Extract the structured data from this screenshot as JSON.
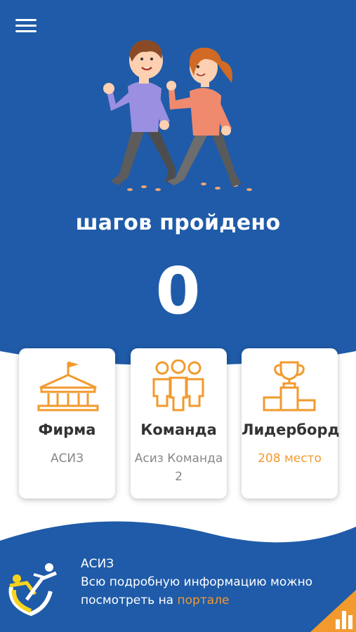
{
  "header": {
    "menu_icon": "hamburger-icon"
  },
  "hero": {
    "illustration": "walking-couple"
  },
  "steps": {
    "label": "шагов пройдено",
    "value": "0"
  },
  "cards": [
    {
      "icon": "company-building-icon",
      "title": "Фирма",
      "subtitle": "АСИЗ"
    },
    {
      "icon": "team-people-icon",
      "title": "Команда",
      "subtitle": "Асиз Команда 2"
    },
    {
      "icon": "trophy-podium-icon",
      "title": "Лидерборд",
      "subtitle": "208 место"
    }
  ],
  "footer": {
    "org": "АСИЗ",
    "info_text": "Всю подробную информацию можно посмотреть на",
    "link_text": "порталe",
    "corner_icon": "bar-chart-icon"
  },
  "colors": {
    "primary": "#1f5ba8",
    "accent": "#f29a2e",
    "text_dark": "#333333",
    "text_gray": "#888888"
  }
}
